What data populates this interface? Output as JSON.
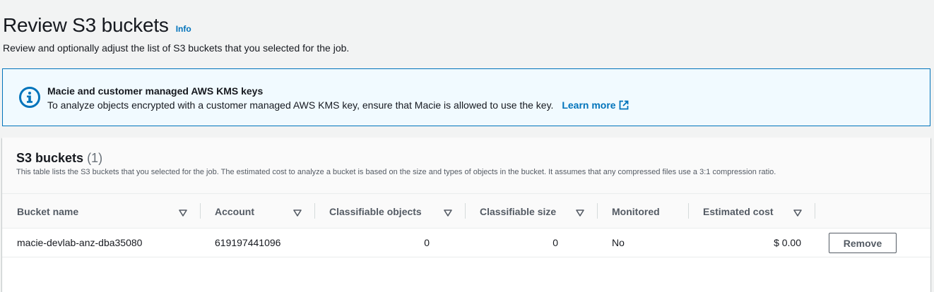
{
  "header": {
    "title": "Review S3 buckets",
    "info_label": "Info",
    "description": "Review and optionally adjust the list of S3 buckets that you selected for the job."
  },
  "alert": {
    "icon": "info-circle-icon",
    "title": "Macie and customer managed AWS KMS keys",
    "text": "To analyze objects encrypted with a customer managed AWS KMS key, ensure that Macie is allowed to use the key.",
    "link_label": "Learn more",
    "link_icon": "external-link-icon"
  },
  "table": {
    "title": "S3 buckets",
    "count": "(1)",
    "description": "This table lists the S3 buckets that you selected for the job. The estimated cost to analyze a bucket is based on the size and types of objects in the bucket. It assumes that any compressed files use a 3:1 compression ratio.",
    "columns": [
      {
        "label": "Bucket name",
        "sortable": true
      },
      {
        "label": "Account",
        "sortable": true
      },
      {
        "label": "Classifiable objects",
        "sortable": true
      },
      {
        "label": "Classifiable size",
        "sortable": true
      },
      {
        "label": "Monitored",
        "sortable": false
      },
      {
        "label": "Estimated cost",
        "sortable": true
      }
    ],
    "rows": [
      {
        "bucket_name": "macie-devlab-anz-dba35080",
        "account": "619197441096",
        "classifiable_objects": "0",
        "classifiable_size": "0",
        "monitored": "No",
        "estimated_cost": "$ 0.00",
        "action_label": "Remove"
      }
    ]
  },
  "colors": {
    "accent": "#0073bb",
    "alert_bg": "#f1faff",
    "page_bg": "#f2f3f3"
  }
}
